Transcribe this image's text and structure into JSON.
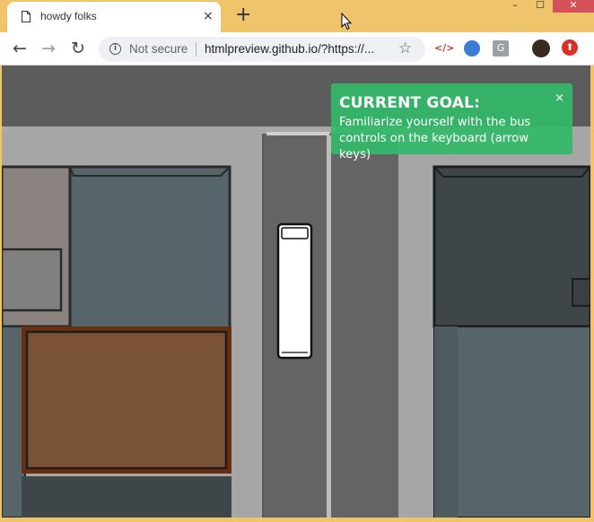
{
  "browser": {
    "tab_title": "howdy folks",
    "tab_close": "×",
    "new_tab": "+",
    "window_controls": {
      "minimize": "–",
      "maximize": "☐",
      "close": "✕"
    },
    "nav": {
      "back": "←",
      "forward": "→",
      "reload": "↻"
    },
    "security_label": "Not secure",
    "url": "htmlpreview.github.io/?https://...",
    "bookmark_icon": "star-icon",
    "extensions": [
      "code-extension-icon",
      "browser-extension-icon",
      "g-extension-icon",
      "profile-avatar",
      "update-extension-icon"
    ],
    "ext_code_glyph": "</>",
    "ext_g_glyph": "G",
    "ext_up_glyph": "⬆",
    "colors": {
      "frame": "#f0c46a",
      "close": "#d6525a"
    }
  },
  "game": {
    "goal": {
      "title": "CURRENT GOAL:",
      "text": "Familiarize yourself with the bus controls on the keyboard (arrow keys)",
      "close": "×",
      "color": "#34b969"
    },
    "colors": {
      "asphalt": "#5c5c5c",
      "road": "#6a6a6a",
      "sidewalk": "#a6a6a6",
      "lane_line": "#bdbdbd",
      "roof_teal": "#56656a",
      "roof_gray": "#7f7f7f",
      "roof_taupe": "#8a8380",
      "roof_brown": "#7a5235",
      "roof_brown_rim": "#6a2f10",
      "roof_dark": "#3f4649",
      "bus": "#ffffff"
    }
  }
}
